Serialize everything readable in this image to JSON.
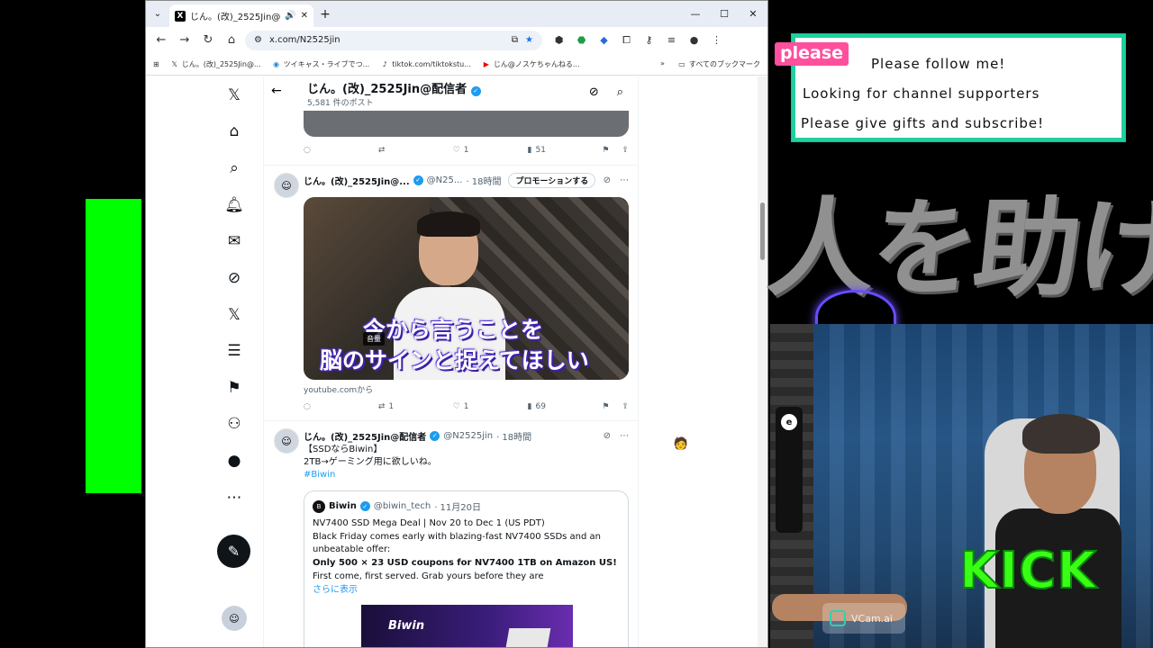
{
  "browser": {
    "tab_title": "じん。(改)_2525Jin@配信者",
    "url": "x.com/N2525jin",
    "bookmarks": [
      {
        "label": "じん。(改)_2525Jin@...",
        "icon": "x-logo"
      },
      {
        "label": "ツイキャス・ライブでつ...",
        "icon": "twitcasting-icon"
      },
      {
        "label": "tiktok.com/tiktokstu...",
        "icon": "tiktok-icon"
      },
      {
        "label": "じん@ノスケちゃんねる...",
        "icon": "youtube-icon"
      }
    ],
    "all_bookmarks_label": "すべてのブックマーク",
    "more_bookmarks": "»"
  },
  "profile_header": {
    "name": "じん。(改)_2525Jin@配信者",
    "post_count": "5,581 件のポスト"
  },
  "post1_actions": {
    "replies": "",
    "reposts": "",
    "likes": "1",
    "views": "51"
  },
  "post2": {
    "name": "じん。(改)_2525Jin@...",
    "handle": "@N25...",
    "time": "· 18時間",
    "promote_label": "プロモーションする",
    "video_caption_line1": "今から言うことを",
    "video_caption_line2": "脳のサインと捉えてほしい",
    "volume_label": "音量",
    "source": "youtube.comから",
    "replies": "",
    "reposts": "1",
    "likes": "1",
    "views": "69"
  },
  "post3": {
    "name": "じん。(改)_2525Jin@配信者",
    "handle": "@N2525jin",
    "time": "· 18時間",
    "text_line1": "【SSDならBiwin】",
    "text_line2": "2TB→ゲーミング用に欲しいね。",
    "hashtag": "#Biwin",
    "quote": {
      "name": "Biwin",
      "handle": "@biwin_tech",
      "time": "· 11月20日",
      "line1": "NV7400 SSD Mega Deal | Nov 20 to Dec 1 (US PDT)",
      "line2": "Black Friday comes early with blazing-fast NV7400 SSDs and an",
      "line3": "unbeatable offer:",
      "line4": "Only 500 × 23 USD coupons for NV7400 1TB on Amazon US!",
      "line5": "First come, first served. Grab yours before they are",
      "show_more": "さらに表示",
      "image_logo": "Biwin"
    }
  },
  "overlay": {
    "please_badge": "please",
    "line1": "Please follow me!",
    "line2": "Looking for channel supporters",
    "line3": "Please give gifts and subscribe!",
    "big_jp": "人を助ける",
    "kick": "KICK",
    "vcam": "VCam.ai"
  },
  "colors": {
    "chroma_green": "#00ff00",
    "x_blue": "#1d9bf0",
    "overlay_border": "#1fd0a0",
    "please_pink": "#ff4f9d",
    "kick_green": "#39ff14"
  }
}
